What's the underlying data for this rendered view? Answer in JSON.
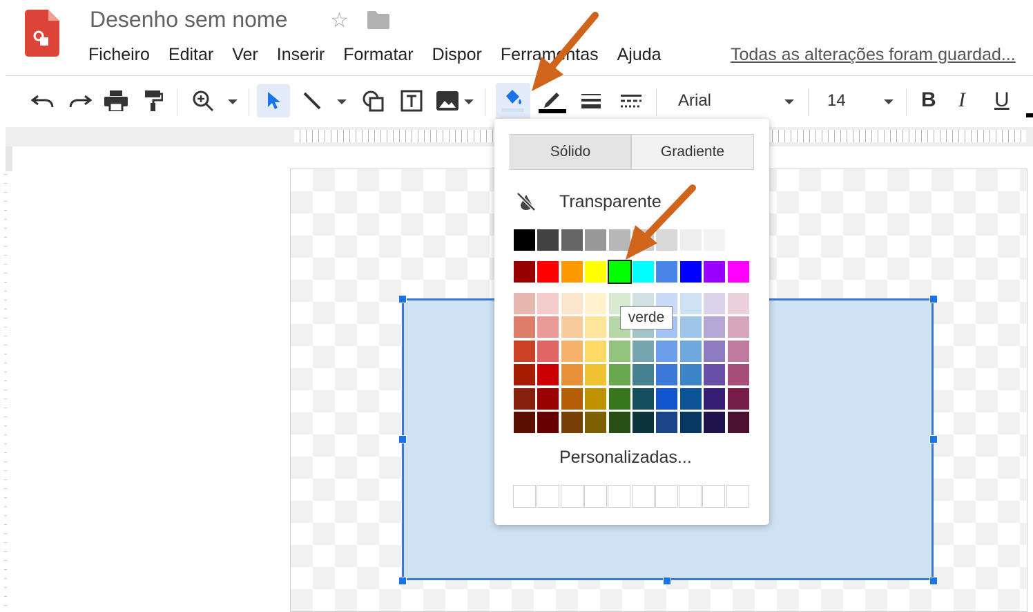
{
  "app": {
    "doc_title": "Desenho sem nome",
    "save_status": "Todas as alterações foram guardad..."
  },
  "menu": [
    "Ficheiro",
    "Editar",
    "Ver",
    "Inserir",
    "Formatar",
    "Dispor",
    "Ferramentas",
    "Ajuda"
  ],
  "toolbar": {
    "icons": [
      "undo-icon",
      "redo-icon",
      "print-icon",
      "paint-format-icon",
      "zoom-icon",
      "select-icon",
      "line-icon",
      "shape-icon",
      "text-box-icon",
      "image-icon",
      "fill-color-icon",
      "border-color-icon",
      "border-weight-icon",
      "border-dash-icon"
    ],
    "font": "Arial",
    "font_size": "14",
    "bold": "B",
    "italic": "I",
    "underline": "U"
  },
  "color_picker": {
    "tab_solid": "Sólido",
    "tab_gradient": "Gradiente",
    "transparent_label": "Transparente",
    "custom_label": "Personalizadas...",
    "tooltip": "verde",
    "selected_color": "#00ff00",
    "grays": [
      "#000000",
      "#434343",
      "#666666",
      "#999999",
      "#b7b7b7",
      "#cccccc",
      "#d9d9d9",
      "#efefef",
      "#f3f3f3",
      "#ffffff"
    ],
    "brights": [
      "#980000",
      "#ff0000",
      "#ff9900",
      "#ffff00",
      "#00ff00",
      "#00ffff",
      "#4a86e8",
      "#0000ff",
      "#9900ff",
      "#ff00ff"
    ],
    "shades": [
      [
        "#e6b8af",
        "#f4cccc",
        "#fce5cd",
        "#fff2cc",
        "#d9ead3",
        "#d0e0e3",
        "#c9daf8",
        "#cfe2f3",
        "#d9d2e9",
        "#ead1dc"
      ],
      [
        "#dd7e6b",
        "#ea9999",
        "#f9cb9c",
        "#ffe599",
        "#b6d7a8",
        "#a2c4c9",
        "#a4c2f4",
        "#9fc5e8",
        "#b4a7d6",
        "#d5a6bd"
      ],
      [
        "#cc4125",
        "#e06666",
        "#f6b26b",
        "#ffd966",
        "#93c47d",
        "#76a5af",
        "#6d9eeb",
        "#6fa8dc",
        "#8e7cc3",
        "#c27ba0"
      ],
      [
        "#a61c00",
        "#cc0000",
        "#e69138",
        "#f1c232",
        "#6aa84f",
        "#45818e",
        "#3c78d8",
        "#3d85c6",
        "#674ea7",
        "#a64d79"
      ],
      [
        "#85200c",
        "#990000",
        "#b45f06",
        "#bf9000",
        "#38761d",
        "#134f5c",
        "#1155cc",
        "#0b5394",
        "#351c75",
        "#741b47"
      ],
      [
        "#5b0f00",
        "#660000",
        "#783f04",
        "#7f6000",
        "#274e13",
        "#0c343d",
        "#1c4587",
        "#073763",
        "#20124d",
        "#4c1130"
      ]
    ]
  },
  "colors": {
    "shape_fill": "#cfe2f3",
    "shape_border": "#3c78d8",
    "accent": "#1a73e8",
    "annotation_arrow": "#d0641b"
  }
}
